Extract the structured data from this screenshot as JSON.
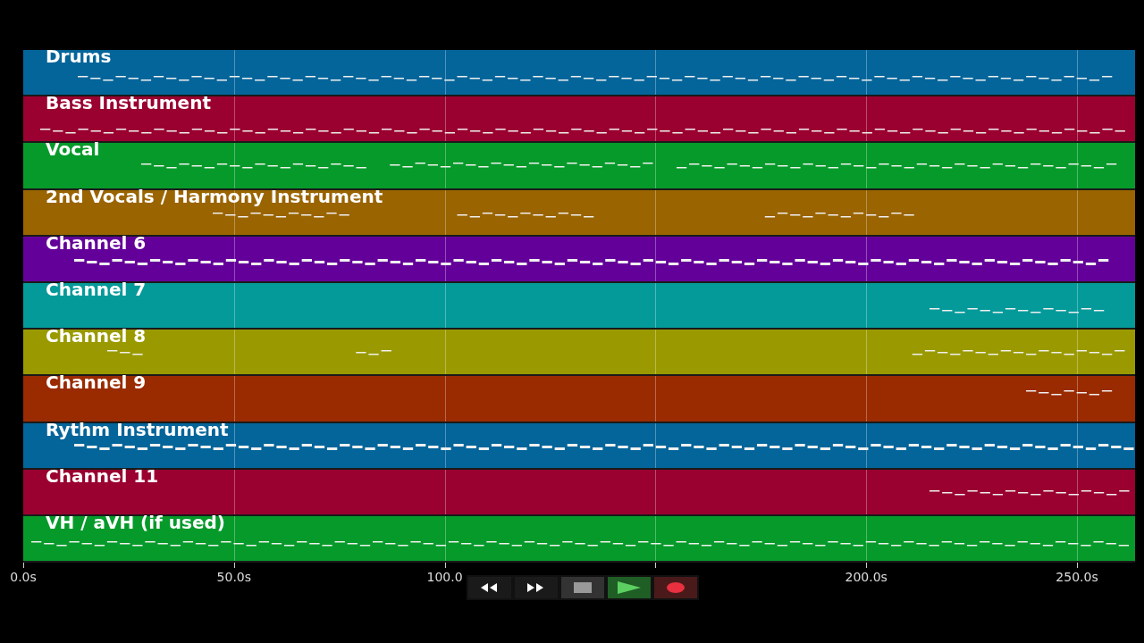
{
  "tracks": [
    {
      "name": "Drums",
      "color": "#04659a"
    },
    {
      "name": "Bass Instrument",
      "color": "#9a0030"
    },
    {
      "name": "Vocal",
      "color": "#069a2a"
    },
    {
      "name": "2nd Vocals / Harmony Instrument",
      "color": "#9a6400"
    },
    {
      "name": "Channel 6",
      "color": "#64009a"
    },
    {
      "name": "Channel 7",
      "color": "#049a9a"
    },
    {
      "name": "Channel 8",
      "color": "#9a9a00"
    },
    {
      "name": "Channel 9",
      "color": "#9a2a00"
    },
    {
      "name": "Rythm Instrument",
      "color": "#04659a"
    },
    {
      "name": "Channel 11",
      "color": "#9a0030"
    },
    {
      "name": "VH / aVH (if used)",
      "color": "#069a2a"
    }
  ],
  "time_axis": [
    {
      "label": "0.0s"
    },
    {
      "label": "50.0s"
    },
    {
      "label": "100.0"
    },
    {
      "label": "200.0s"
    },
    {
      "label": "250.0s"
    }
  ],
  "transport": [
    {
      "kind": "rewind"
    },
    {
      "kind": "forward"
    },
    {
      "kind": "stop"
    },
    {
      "kind": "play"
    },
    {
      "kind": "record"
    }
  ]
}
